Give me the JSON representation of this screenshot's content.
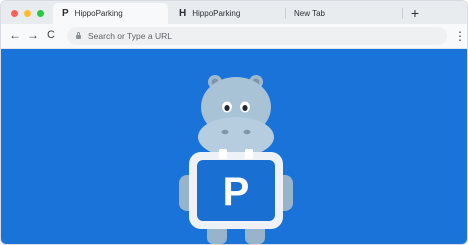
{
  "tabs": [
    {
      "favicon": "P",
      "title": "HippoParking",
      "active": true
    },
    {
      "favicon": "H",
      "title": "HippoParking",
      "active": false
    },
    {
      "favicon": "",
      "title": "New Tab",
      "active": false
    }
  ],
  "new_tab_label": "+",
  "nav": {
    "back": "←",
    "forward": "→",
    "reload": "C",
    "menu": "⋮"
  },
  "address_bar": {
    "value": "",
    "placeholder": "Search or Type a URL"
  },
  "page": {
    "sign_letter": "P"
  },
  "colors": {
    "page_background": "#1a73d9",
    "hippo": "#a8c2d6",
    "sign": "#1a6fd2"
  }
}
